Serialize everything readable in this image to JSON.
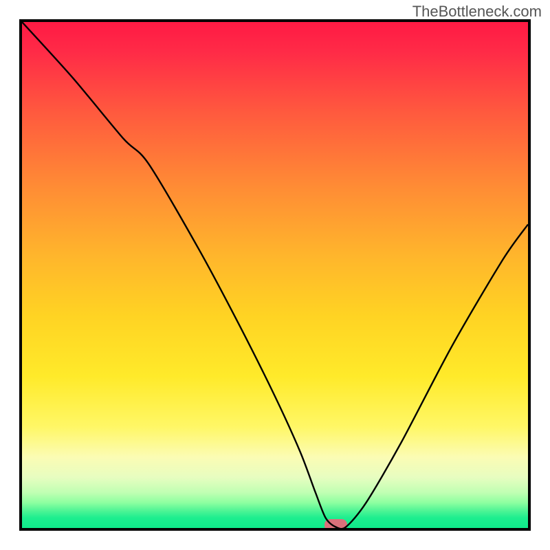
{
  "watermark": "TheBottleneck.com",
  "chart_data": {
    "type": "line",
    "title": "",
    "xlabel": "",
    "ylabel": "",
    "xlim": [
      0,
      100
    ],
    "ylim": [
      0,
      100
    ],
    "notes": "Unlabeled axes; vertical gradient background encodes quality from red (high y) through orange/yellow (mid) to green (y≈0). Single black curve forming a V-shaped dip with minimum near x≈62. A small rounded pink marker sits at the minimum on the x-axis.",
    "series": [
      {
        "name": "curve",
        "x": [
          0,
          10,
          20,
          25,
          35,
          43,
          50,
          55,
          58,
          60,
          62,
          64,
          68,
          75,
          85,
          95,
          100
        ],
        "values": [
          100,
          89,
          77,
          72,
          55,
          40,
          26,
          15,
          7,
          2,
          0.2,
          0.2,
          5,
          17,
          36,
          53,
          60
        ]
      }
    ],
    "marker": {
      "x": 62,
      "y": 0.5,
      "radius_x": 2.2,
      "radius_y": 1.2,
      "color": "#d9707a"
    },
    "gradient_stops": [
      {
        "pct": 0,
        "color": "#ff1a44"
      },
      {
        "pct": 6,
        "color": "#ff2b47"
      },
      {
        "pct": 18,
        "color": "#ff5a3e"
      },
      {
        "pct": 32,
        "color": "#ff8a35"
      },
      {
        "pct": 46,
        "color": "#ffb52c"
      },
      {
        "pct": 58,
        "color": "#ffd323"
      },
      {
        "pct": 70,
        "color": "#ffea2a"
      },
      {
        "pct": 80,
        "color": "#fff766"
      },
      {
        "pct": 86,
        "color": "#fbfcb4"
      },
      {
        "pct": 90,
        "color": "#e7fdc0"
      },
      {
        "pct": 93,
        "color": "#c0ffb3"
      },
      {
        "pct": 95,
        "color": "#8dffa0"
      },
      {
        "pct": 96.5,
        "color": "#52f596"
      },
      {
        "pct": 98,
        "color": "#1dee8f"
      },
      {
        "pct": 100,
        "color": "#0fe98a"
      }
    ]
  }
}
